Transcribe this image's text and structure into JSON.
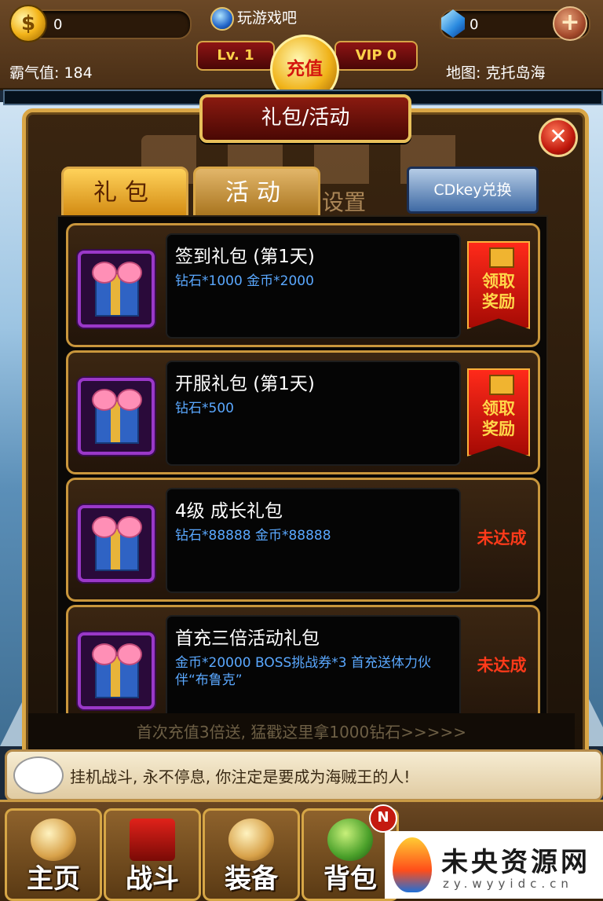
{
  "header": {
    "gold": "0",
    "game_name": "玩游戏吧",
    "diamonds": "0",
    "plus_glyph": "+",
    "level": "Lv. 1",
    "recharge": "充值",
    "vip": "VIP 0",
    "power": "霸气值: 184",
    "map": "地图: 克托岛海"
  },
  "panel": {
    "title": "礼包/活动",
    "close_glyph": "✕",
    "tabs": [
      {
        "label": "礼包",
        "active": true
      },
      {
        "label": "活动",
        "active": false
      }
    ],
    "ghost_tab": "设置",
    "cdkey": "CDkey兑换"
  },
  "gifts": [
    {
      "title": "签到礼包 (第1天)",
      "reward": "钻石*1000 金币*2000",
      "status": "claim",
      "claim_label": "领取奖励"
    },
    {
      "title": "开服礼包 (第1天)",
      "reward": "钻石*500",
      "status": "claim",
      "claim_label": "领取奖励"
    },
    {
      "title": "4级 成长礼包",
      "reward": "钻石*88888 金币*88888",
      "status": "unmet",
      "unmet_label": "未达成"
    },
    {
      "title": "首充三倍活动礼包",
      "reward": "金币*20000 BOSS挑战券*3 首充送体力伙伴“布鲁克”",
      "status": "unmet",
      "unmet_label": "未达成"
    }
  ],
  "banner": "首次充值3倍送, 猛戳这里拿1000钻石>>>>>",
  "chat": "挂机战斗, 永不停息, 你注定是要成为海贼王的人!",
  "nav": [
    {
      "label": "主页"
    },
    {
      "label": "战斗"
    },
    {
      "label": "装备"
    },
    {
      "label": "背包",
      "badge": "N"
    }
  ],
  "watermark": {
    "title": "未央资源网",
    "url": "zy.wyyidc.cn"
  }
}
